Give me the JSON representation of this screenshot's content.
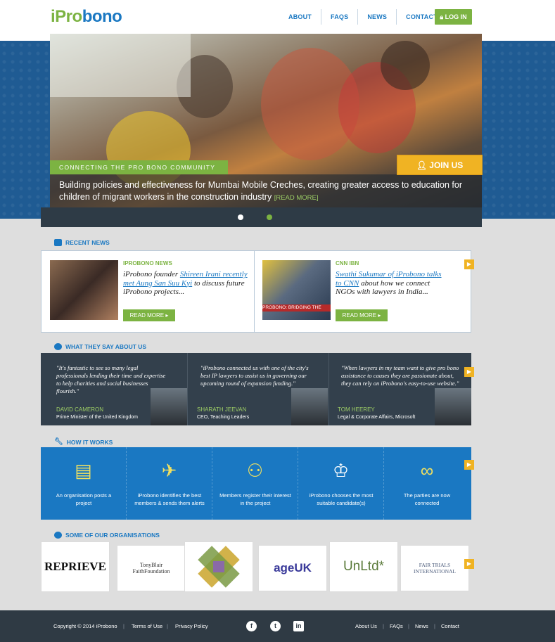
{
  "header": {
    "logo_prefix": "iPro",
    "logo_suffix": "bono",
    "nav": [
      "ABOUT",
      "FAQS",
      "NEWS",
      "CONTACT"
    ],
    "login_label": "LOG IN"
  },
  "hero": {
    "tag": "CONNECTING THE PRO BONO COMMUNITY",
    "caption": "Building policies and effectiveness for Mumbai Mobile Creches, creating greater access to education for children of migrant workers in the construction industry",
    "read_more": "[READ MORE]",
    "join_label": "JOIN US"
  },
  "recent_news": {
    "title": "RECENT NEWS",
    "items": [
      {
        "category": "IPROBONO NEWS",
        "text_before": "iProbono founder ",
        "link_text": "Shireen Irani recently met Aung San Suu Kyi",
        "text_after": " to discuss future iProbono projects...",
        "read_more": "READ MORE"
      },
      {
        "category": "CNN IBN",
        "text_before": "",
        "link_text": "Swathi Sukumar of iProbono talks to CNN",
        "text_after": " about how we connect NGOs with lawyers in India...",
        "read_more": "READ MORE",
        "image_caption": "PROBONO: BRIDGING THE"
      }
    ]
  },
  "testimonials": {
    "title": "WHAT THEY SAY ABOUT US",
    "items": [
      {
        "quote": "\"It's fantastic to see so many legal professionals lending their time and expertise to help charities and social businesses flourish.\"",
        "name": "DAVID CAMERON",
        "role": "Prime Minister of the United Kingdom"
      },
      {
        "quote": "\"iProbono connected us with one of the city's best IP lawyers to assist us in governing our upcoming round of expansion funding.\"",
        "name": "SHARATH JEEVAN",
        "role": "CEO, Teaching Leaders"
      },
      {
        "quote": "\"When lawyers in my team want to give pro bono assistance to causes they are passionate about, they can rely on iProbono's easy-to-use website.\"",
        "name": "TOM HEEREY",
        "role": "Legal & Corporate Affairs, Microsoft"
      }
    ]
  },
  "how_it_works": {
    "title": "HOW IT WORKS",
    "steps": [
      {
        "text": "An organisation posts a project",
        "icon": "document-icon"
      },
      {
        "text": "iProbono identifies the best members & sends them alerts",
        "icon": "paper-plane-icon"
      },
      {
        "text": "Members register their interest in the project",
        "icon": "people-icon"
      },
      {
        "text": "iProbono chooses the most suitable candidate(s)",
        "icon": "crowned-person-icon"
      },
      {
        "text": "The parties are now connected",
        "icon": "linked-rings-icon"
      }
    ]
  },
  "organisations": {
    "title": "SOME OF OUR ORGANISATIONS",
    "items": [
      "REPRIEVE",
      "TonyBlair FaithFoundation",
      "",
      "ageUK",
      "UnLtd*",
      "FAIR TRIALS INTERNATIONAL"
    ]
  },
  "footer": {
    "copyright": "Copyright © 2014 iProbono",
    "terms": "Terms of Use",
    "privacy": "Privacy Policy",
    "links": [
      "About Us",
      "FAQs",
      "News",
      "Contact"
    ]
  },
  "colors": {
    "brand_blue": "#1a78c2",
    "brand_green": "#7cb342",
    "accent_yellow": "#f0b323",
    "dark_panel": "#33404c"
  }
}
